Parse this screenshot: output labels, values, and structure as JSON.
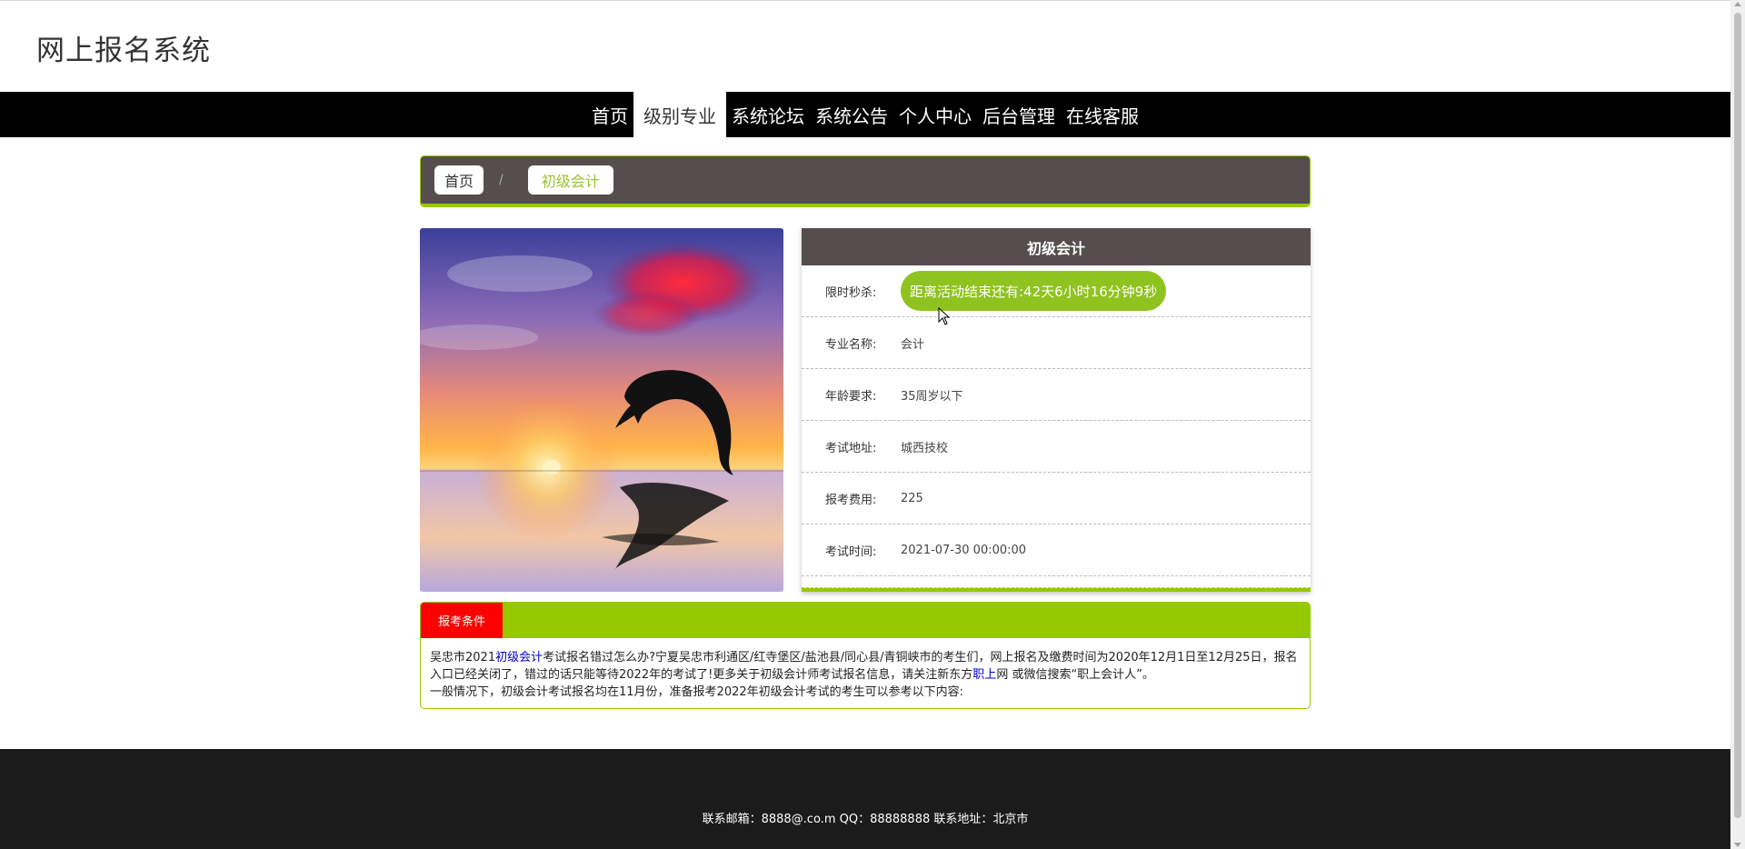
{
  "header": {
    "site_title": "网上报名系统"
  },
  "nav": {
    "items": [
      {
        "label": "首页",
        "active": false
      },
      {
        "label": "级别专业",
        "active": true
      },
      {
        "label": "系统论坛",
        "active": false
      },
      {
        "label": "系统公告",
        "active": false
      },
      {
        "label": "个人中心",
        "active": false
      },
      {
        "label": "后台管理",
        "active": false
      },
      {
        "label": "在线客服",
        "active": false
      }
    ]
  },
  "breadcrumb": {
    "home": "首页",
    "separator": "/",
    "current": "初级会计"
  },
  "detail": {
    "title": "初级会计",
    "countdown_label": "限时秒杀:",
    "countdown_text": "距离活动结束还有:42天6小时16分钟9秒",
    "rows": [
      {
        "label": "专业名称:",
        "value": "会计"
      },
      {
        "label": "年龄要求:",
        "value": "35周岁以下"
      },
      {
        "label": "考试地址:",
        "value": "城西技校"
      },
      {
        "label": "报考费用:",
        "value": "225"
      },
      {
        "label": "考试时间:",
        "value": "2021-07-30 00:00:00"
      }
    ]
  },
  "conditions": {
    "tab_label": "报考条件",
    "line1_a": "吴忠市2021",
    "line1_link": "初级会计",
    "line1_b": "考试报名错过怎么办?宁夏吴忠市利通区/红寺堡区/盐池县/同心县/青铜峡市的考生们，网上报名及缴费时间为2020年12月1日至12月25日，报名入口已经关闭了，错过的话只能等待2022年的考试了!更多关于初级会计师考试报名信息，请关注新东方",
    "line1_link2": "职上",
    "line1_c": "网 或微信搜索“职上会计人”。",
    "line2": "一般情况下，初级会计考试报名均在11月份，准备报考2022年初级会计考试的考生可以参考以下内容:"
  },
  "footer": {
    "text": "联系邮箱：8888@.co.m QQ：88888888 联系地址：北京市"
  },
  "colors": {
    "accent_green": "#97c900",
    "header_brown": "#564e4e",
    "tab_red": "#ff0000"
  }
}
